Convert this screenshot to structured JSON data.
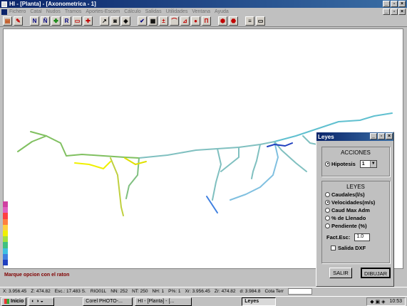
{
  "window": {
    "title": "HI - [Planta] - [Axonometrica - 1]"
  },
  "menubar": {
    "items": [
      "Fichero",
      "Catal",
      "Nudos",
      "Tramos",
      "Aportes-Escom",
      "Cálculo",
      "Salidas",
      "Utilidades",
      "Ventana",
      "Ayuda"
    ]
  },
  "status": {
    "message": "Marque opcion con el raton"
  },
  "coords": {
    "x": "X: 3.956.45",
    "z": "Z: 474.82",
    "esc": "Esc.: 17.483 S.",
    "rio": "RIO01L",
    "nn": "NN: 252",
    "nt": "NT: 250",
    "nh": "NH: 1",
    "p": "P%: 1",
    "xr": "Xr: 3.956.45",
    "zr": "Zr: 474.82",
    "d": "d: 3.984.8",
    "cotaterr": "Cota Terr"
  },
  "taskbar": {
    "start": "Inicio",
    "tasks": [
      "Corel PHOTO-...",
      "HI - [Planta] - [...",
      "Leyes"
    ],
    "clock": "10:53"
  },
  "dialog": {
    "title": "Leyes",
    "acciones_title": "ACCIONES",
    "hipotesis_label": "Hipotesis",
    "hipotesis_value": "1",
    "leyes_title": "LEYES",
    "options": [
      "Caudales(l/s)",
      "Velocidades(m/s)",
      "Caud Max Adm",
      "% de Llenado",
      "Pendiente (%)"
    ],
    "selected_option": 1,
    "fact_label": "Fact.Esc:",
    "fact_value": "1.0",
    "salida_label": "Salida DXF",
    "salir_label": "SALIR",
    "dibujar_label": "DIBUJAR"
  },
  "legend_colors": [
    "#d040a0",
    "#e060c0",
    "#ff4040",
    "#ff8040",
    "#ffd040",
    "#f0f000",
    "#a0e040",
    "#40c080",
    "#40c0e0",
    "#4080e0",
    "#2040c0"
  ],
  "icons": {
    "toolbar": [
      "printer-icon",
      "edit-icon",
      "node-n-icon",
      "node-nt-icon",
      "node-r-icon",
      "pipe-icon",
      "cross-icon",
      "tool-icon",
      "camera-icon",
      "view3d-icon",
      "check-icon",
      "calc-icon",
      "line-icon",
      "arc-icon",
      "circle-icon",
      "bridge-icon",
      "stop-icon",
      "stop2-icon",
      "list-icon",
      "window-icon"
    ]
  }
}
